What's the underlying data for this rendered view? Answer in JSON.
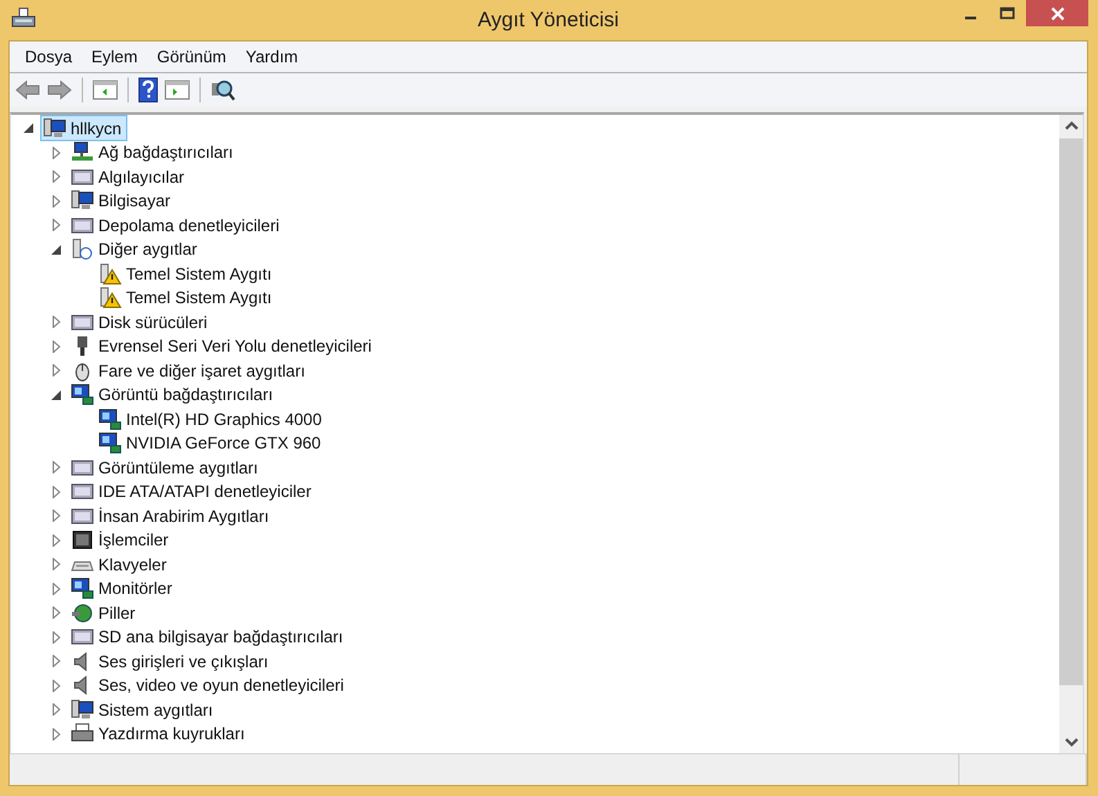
{
  "window": {
    "title": "Aygıt Yöneticisi"
  },
  "menu": [
    "Dosya",
    "Eylem",
    "Görünüm",
    "Yardım"
  ],
  "tree": {
    "label": "hllkycn",
    "selected": true,
    "expanded": true,
    "children": [
      {
        "label": "Ağ bağdaştırıcıları",
        "expanded": false,
        "warning": false
      },
      {
        "label": "Algılayıcılar",
        "expanded": false,
        "warning": false
      },
      {
        "label": "Bilgisayar",
        "expanded": false,
        "warning": false
      },
      {
        "label": "Depolama denetleyicileri",
        "expanded": false,
        "warning": false
      },
      {
        "label": "Diğer aygıtlar",
        "expanded": true,
        "warning": false,
        "children": [
          {
            "label": "Temel Sistem Aygıtı",
            "warning": true
          },
          {
            "label": "Temel Sistem Aygıtı",
            "warning": true
          }
        ]
      },
      {
        "label": "Disk sürücüleri",
        "expanded": false,
        "warning": false
      },
      {
        "label": "Evrensel Seri Veri Yolu denetleyicileri",
        "expanded": false,
        "warning": false
      },
      {
        "label": "Fare ve diğer işaret aygıtları",
        "expanded": false,
        "warning": false
      },
      {
        "label": "Görüntü bağdaştırıcıları",
        "expanded": true,
        "warning": false,
        "children": [
          {
            "label": "Intel(R) HD Graphics 4000",
            "warning": false
          },
          {
            "label": "NVIDIA GeForce GTX 960",
            "warning": false
          }
        ]
      },
      {
        "label": "Görüntüleme aygıtları",
        "expanded": false,
        "warning": false
      },
      {
        "label": "IDE ATA/ATAPI denetleyiciler",
        "expanded": false,
        "warning": false
      },
      {
        "label": "İnsan Arabirim Aygıtları",
        "expanded": false,
        "warning": false
      },
      {
        "label": "İşlemciler",
        "expanded": false,
        "warning": false
      },
      {
        "label": "Klavyeler",
        "expanded": false,
        "warning": false
      },
      {
        "label": "Monitörler",
        "expanded": false,
        "warning": false
      },
      {
        "label": "Piller",
        "expanded": false,
        "warning": false
      },
      {
        "label": "SD ana bilgisayar bağdaştırıcıları",
        "expanded": false,
        "warning": false
      },
      {
        "label": "Ses girişleri ve çıkışları",
        "expanded": false,
        "warning": false
      },
      {
        "label": "Ses, video ve oyun denetleyicileri",
        "expanded": false,
        "warning": false
      },
      {
        "label": "Sistem aygıtları",
        "expanded": false,
        "warning": false
      },
      {
        "label": "Yazdırma kuyrukları",
        "expanded": false,
        "warning": false
      }
    ]
  }
}
